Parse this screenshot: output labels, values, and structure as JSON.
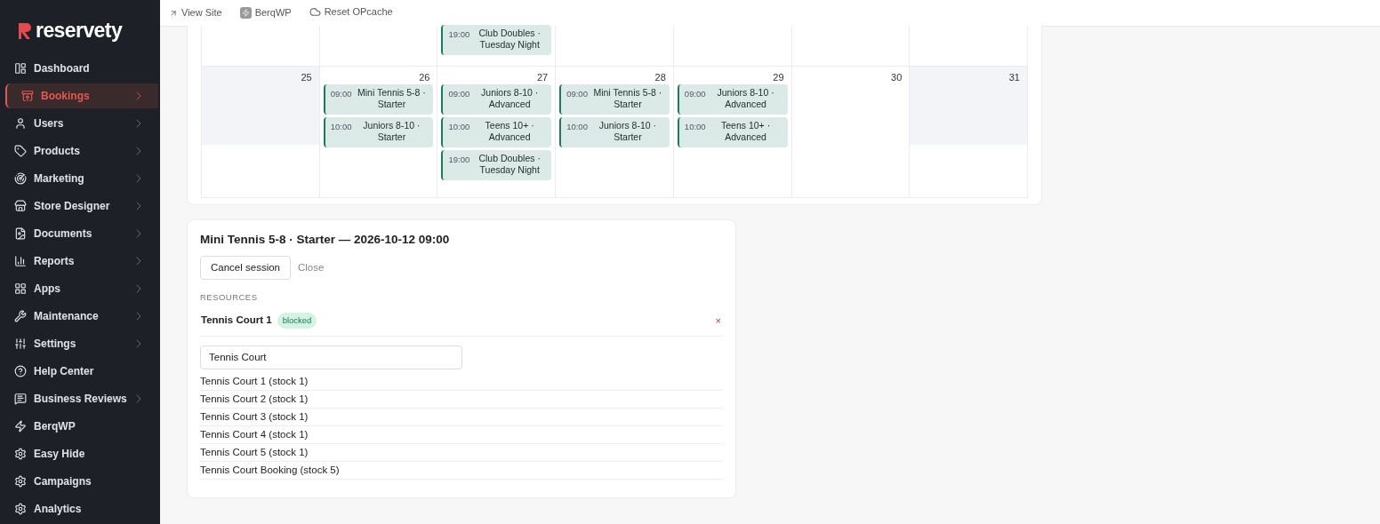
{
  "sidebar": {
    "brand": "reservety",
    "items": [
      {
        "label": "Dashboard",
        "selected": false,
        "has_submenu": false
      },
      {
        "label": "Bookings",
        "selected": true,
        "has_submenu": true
      },
      {
        "label": "Users",
        "selected": false,
        "has_submenu": true
      },
      {
        "label": "Products",
        "selected": false,
        "has_submenu": true
      },
      {
        "label": "Marketing",
        "selected": false,
        "has_submenu": true
      },
      {
        "label": "Store Designer",
        "selected": false,
        "has_submenu": true
      },
      {
        "label": "Documents",
        "selected": false,
        "has_submenu": true
      },
      {
        "label": "Reports",
        "selected": false,
        "has_submenu": true
      },
      {
        "label": "Apps",
        "selected": false,
        "has_submenu": true
      },
      {
        "label": "Maintenance",
        "selected": false,
        "has_submenu": true
      },
      {
        "label": "Settings",
        "selected": false,
        "has_submenu": true
      },
      {
        "label": "Help Center",
        "selected": false,
        "has_submenu": false
      },
      {
        "label": "Business Reviews",
        "selected": false,
        "has_submenu": true
      },
      {
        "label": "BerqWP",
        "selected": false,
        "has_submenu": false
      },
      {
        "label": "Easy Hide",
        "selected": false,
        "has_submenu": false
      },
      {
        "label": "Campaigns",
        "selected": false,
        "has_submenu": false
      },
      {
        "label": "Analytics",
        "selected": false,
        "has_submenu": false
      }
    ]
  },
  "top_bar": {
    "links": [
      "View Site",
      "BerqWP",
      "Reset OPcache"
    ]
  },
  "calendar": {
    "weeks": [
      {
        "days": [
          {
            "muted": false
          },
          {
            "muted": false
          },
          {
            "muted": false,
            "events": [
              {
                "time": "19:00",
                "title": "Club Doubles · Tuesday Night"
              }
            ]
          },
          {
            "muted": false
          },
          {
            "muted": false
          },
          {
            "muted": false
          },
          {
            "muted": false
          }
        ]
      },
      {
        "days": [
          {
            "date": "25",
            "muted": true
          },
          {
            "date": "26",
            "muted": false,
            "events": [
              {
                "time": "09:00",
                "title": "Mini Tennis 5-8 · Starter"
              },
              {
                "time": "10:00",
                "title": "Juniors 8-10 · Starter"
              }
            ]
          },
          {
            "date": "27",
            "muted": false,
            "events": [
              {
                "time": "09:00",
                "title": "Juniors 8-10 · Advanced"
              },
              {
                "time": "10:00",
                "title": "Teens 10+ · Advanced"
              },
              {
                "time": "19:00",
                "title": "Club Doubles · Tuesday Night"
              }
            ]
          },
          {
            "date": "28",
            "muted": false,
            "events": [
              {
                "time": "09:00",
                "title": "Mini Tennis 5-8 · Starter"
              },
              {
                "time": "10:00",
                "title": "Juniors 8-10 · Starter"
              }
            ]
          },
          {
            "date": "29",
            "muted": false,
            "events": [
              {
                "time": "09:00",
                "title": "Juniors 8-10 · Advanced"
              },
              {
                "time": "10:00",
                "title": "Teens 10+ · Advanced"
              }
            ]
          },
          {
            "date": "30",
            "muted": false
          },
          {
            "date": "31",
            "muted": true
          }
        ]
      }
    ]
  },
  "session": {
    "title": "Mini Tennis 5-8 · Starter — 2026-10-12 09:00",
    "buttons": [
      "Cancel session",
      "Close"
    ],
    "resources_heading": "RESOURCES",
    "resources": [
      {
        "name": "Tennis Court 1",
        "status": "blocked",
        "remove": "×"
      }
    ],
    "search": {
      "value": "Tennis Court"
    },
    "results": [
      "Tennis Court 1 (stock 1)",
      "Tennis Court 2 (stock 1)",
      "Tennis Court 3 (stock 1)",
      "Tennis Court 4 (stock 1)",
      "Tennis Court 5 (stock 1)",
      "Tennis Court Booking (stock 5)"
    ]
  }
}
